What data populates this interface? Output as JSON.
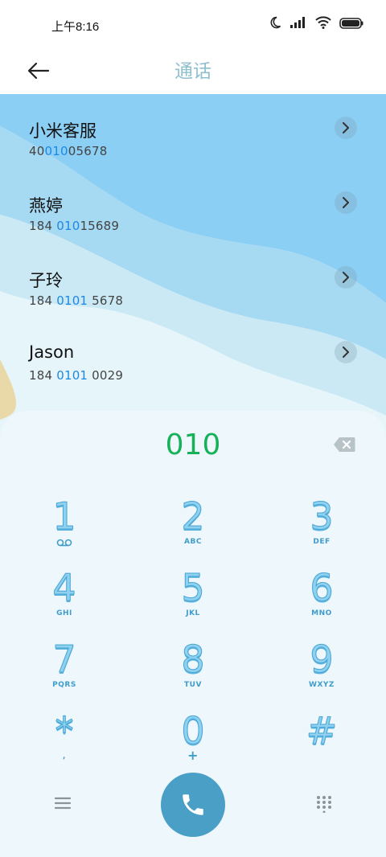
{
  "status_bar": {
    "time": "上午8:16",
    "icons": [
      "moon-icon",
      "signal-icon",
      "wifi-icon",
      "battery-icon"
    ]
  },
  "header": {
    "title": "通话",
    "back_icon": "back-arrow-icon"
  },
  "contacts": [
    {
      "name": "小米客服",
      "number_pre": "40",
      "number_hl": "010",
      "number_post": "05678"
    },
    {
      "name": "燕婷",
      "number_pre": "184 ",
      "number_hl": "010",
      "number_post": "15689"
    },
    {
      "name": "子玲",
      "number_pre": "184 ",
      "number_hl": "0101",
      "number_post": " 5678"
    },
    {
      "name": "Jason",
      "number_pre": "184 ",
      "number_hl": "0101",
      "number_post": " 0029"
    }
  ],
  "dialer": {
    "input_value": "010",
    "keys": [
      {
        "digit": "1",
        "sub": ""
      },
      {
        "digit": "2",
        "sub": "ABC"
      },
      {
        "digit": "3",
        "sub": "DEF"
      },
      {
        "digit": "4",
        "sub": "GHI"
      },
      {
        "digit": "5",
        "sub": "JKL"
      },
      {
        "digit": "6",
        "sub": "MNO"
      },
      {
        "digit": "7",
        "sub": "PQRS"
      },
      {
        "digit": "8",
        "sub": "TUV"
      },
      {
        "digit": "9",
        "sub": "WXYZ"
      },
      {
        "digit": "*",
        "sub": ","
      },
      {
        "digit": "0",
        "sub": "+"
      },
      {
        "digit": "#",
        "sub": ""
      }
    ]
  },
  "colors": {
    "accent_green": "#17b15a",
    "highlight_blue": "#1e88e5",
    "call_button": "#4a9fc6",
    "header_title": "#8fbfcf"
  }
}
